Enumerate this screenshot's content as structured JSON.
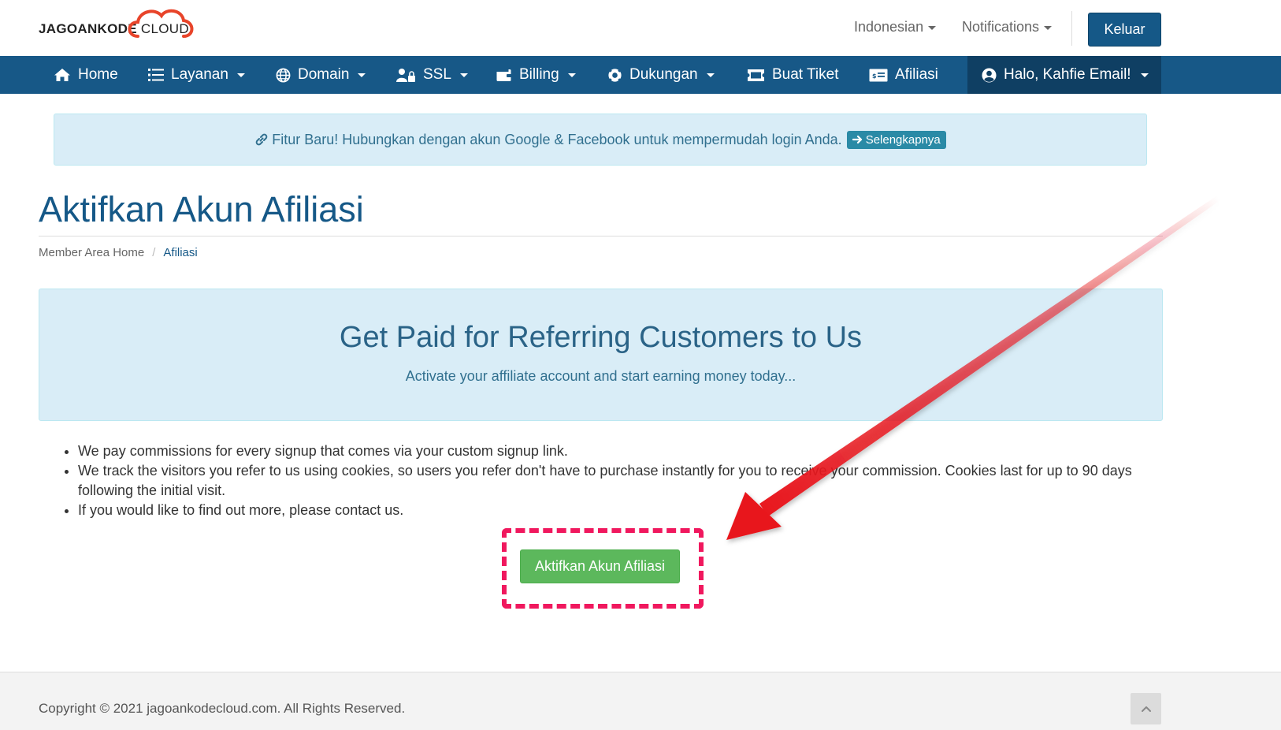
{
  "brand": {
    "name_bold": "JAGOANKODE",
    "name_light": "CLOUD",
    "color_red": "#e8442a",
    "color_dark": "#222222"
  },
  "header": {
    "language": "Indonesian",
    "notifications": "Notifications",
    "logout_label": "Keluar"
  },
  "nav": {
    "items": [
      {
        "label": "Home",
        "icon": "home-icon"
      },
      {
        "label": "Layanan",
        "icon": "list-icon"
      },
      {
        "label": "Domain",
        "icon": "globe-icon"
      },
      {
        "label": "SSL",
        "icon": "users-lock-icon"
      },
      {
        "label": "Billing",
        "icon": "wallet-icon"
      },
      {
        "label": "Dukungan",
        "icon": "lifebuoy-icon"
      },
      {
        "label": "Buat Tiket",
        "icon": "ticket-icon"
      },
      {
        "label": "Afiliasi",
        "icon": "money-bill-icon"
      }
    ],
    "user_label": "Halo, Kahfie Email!"
  },
  "notice": {
    "text": "Fitur Baru! Hubungkan dengan akun Google & Facebook untuk mempermudah login Anda.",
    "button_label": "Selengkapnya"
  },
  "page": {
    "title": "Aktifkan Akun Afiliasi",
    "breadcrumb": {
      "home": "Member Area Home",
      "current": "Afiliasi"
    }
  },
  "jumbotron": {
    "title": "Get Paid for Referring Customers to Us",
    "subtitle": "Activate your affiliate account and start earning money today..."
  },
  "benefits": [
    "We pay commissions for every signup that comes via your custom signup link.",
    "We track the visitors you refer to us using cookies, so users you refer don't have to purchase instantly for you to receive your commission. Cookies last for up to 90 days following the initial visit.",
    "If you would like to find out more, please contact us."
  ],
  "activate_button": "Aktifkan Akun Afiliasi",
  "footer": {
    "copyright": "Copyright © 2021 jagoankodecloud.com. All Rights Reserved."
  },
  "colors": {
    "nav": "#175887",
    "nav_active": "#0f3f63",
    "accent": "#155887",
    "success": "#5cb85c",
    "highlight": "#f0185e",
    "arrow": "#e8141c"
  }
}
